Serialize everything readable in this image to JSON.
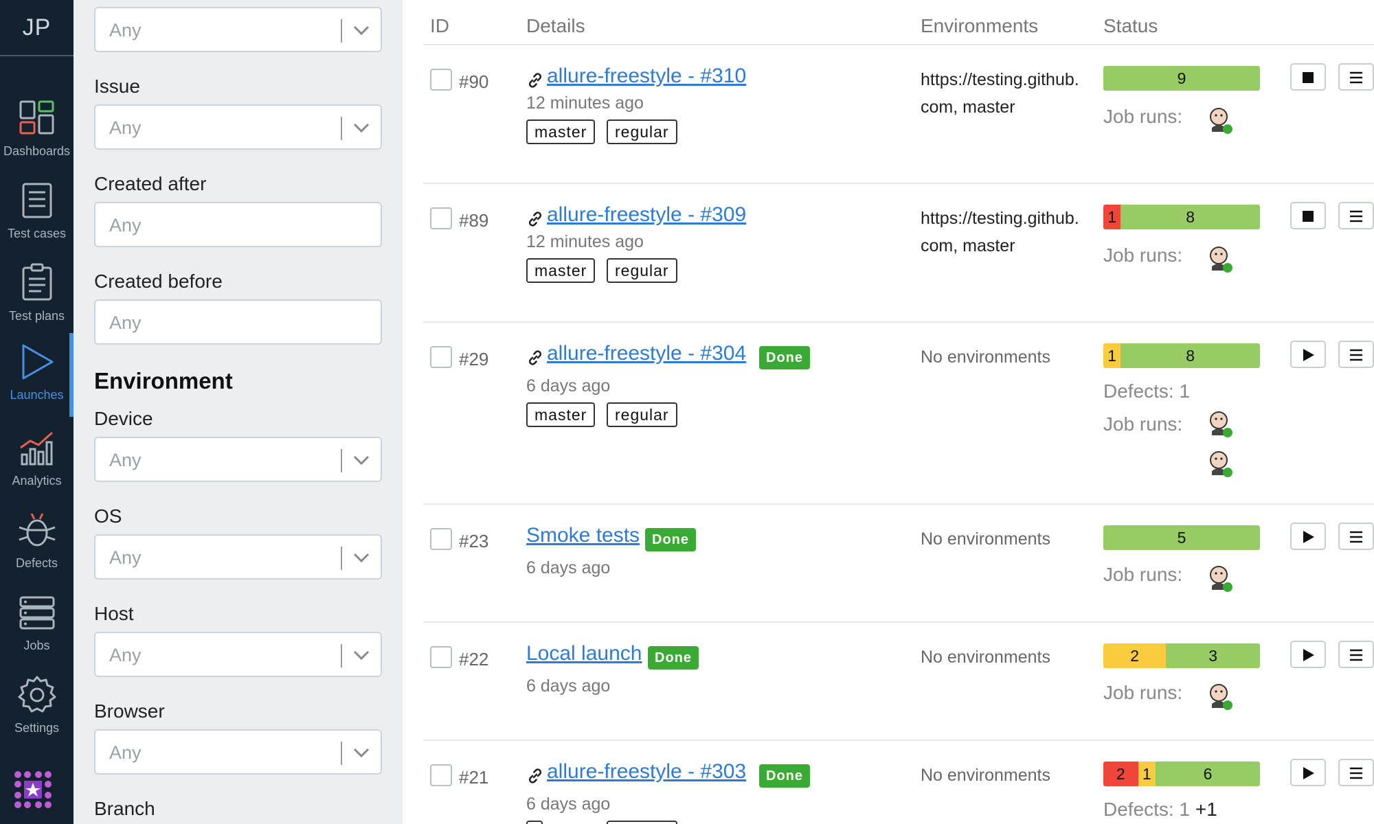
{
  "nav": {
    "brand": "JP",
    "items": [
      {
        "label": "Dashboards",
        "icon": "dashboards-icon"
      },
      {
        "label": "Test cases",
        "icon": "test-cases-icon"
      },
      {
        "label": "Test plans",
        "icon": "test-plans-icon"
      },
      {
        "label": "Launches",
        "icon": "launches-icon",
        "active": true
      },
      {
        "label": "Analytics",
        "icon": "analytics-icon"
      },
      {
        "label": "Defects",
        "icon": "defects-icon"
      },
      {
        "label": "Jobs",
        "icon": "jobs-icon"
      },
      {
        "label": "Settings",
        "icon": "settings-icon"
      }
    ]
  },
  "filters": {
    "top_value": "Any",
    "issue": {
      "label": "Issue",
      "value": "Any"
    },
    "created_after": {
      "label": "Created after",
      "value": "Any"
    },
    "created_before": {
      "label": "Created before",
      "value": "Any"
    },
    "environment_heading": "Environment",
    "device": {
      "label": "Device",
      "value": "Any"
    },
    "os": {
      "label": "OS",
      "value": "Any"
    },
    "host": {
      "label": "Host",
      "value": "Any"
    },
    "browser": {
      "label": "Browser",
      "value": "Any"
    },
    "branch": {
      "label": "Branch"
    }
  },
  "table": {
    "headers": {
      "id": "ID",
      "details": "Details",
      "environments": "Environments",
      "status": "Status"
    },
    "job_runs_label": "Job runs:",
    "done_label": "Done",
    "rows": [
      {
        "id": "#90",
        "title": "allure-freestyle - #310",
        "ago": "12 minutes ago",
        "tags": [
          "master",
          "regular"
        ],
        "env_line1": "https://testing.github.",
        "env_line2": "com, master",
        "bar": [
          {
            "v": 9,
            "c": "green"
          }
        ]
      },
      {
        "id": "#89",
        "title": "allure-freestyle - #309",
        "ago": "12 minutes ago",
        "tags": [
          "master",
          "regular"
        ],
        "env_line1": "https://testing.github.",
        "env_line2": "com, master",
        "bar": [
          {
            "v": 1,
            "c": "red"
          },
          {
            "v": 8,
            "c": "green"
          }
        ]
      },
      {
        "id": "#29",
        "title": "allure-freestyle - #304",
        "ago": "6 days ago",
        "tags": [
          "master",
          "regular"
        ],
        "env": "No environments",
        "bar": [
          {
            "v": 1,
            "c": "yellow"
          },
          {
            "v": 8,
            "c": "green"
          }
        ],
        "defects": "Defects: 1"
      },
      {
        "id": "#23",
        "title": "Smoke tests",
        "ago": "6 days ago",
        "env": "No environments",
        "bar": [
          {
            "v": 5,
            "c": "green"
          }
        ]
      },
      {
        "id": "#22",
        "title": "Local launch",
        "ago": "6 days ago",
        "env": "No environments",
        "bar": [
          {
            "v": 2,
            "c": "yellow"
          },
          {
            "v": 3,
            "c": "green"
          }
        ]
      },
      {
        "id": "#21",
        "title": "allure-freestyle - #303",
        "ago": "6 days ago",
        "env": "No environments",
        "bar": [
          {
            "v": 2,
            "c": "red"
          },
          {
            "v": 1,
            "c": "yellow"
          },
          {
            "v": 6,
            "c": "green"
          }
        ],
        "defects_prefix": "Defects: 1",
        "defects_extra": "+1"
      }
    ]
  },
  "colors": {
    "accent": "#4a90e2",
    "link": "#2e7bd6",
    "done": "#3aaa35",
    "green": "#97cc64",
    "yellow": "#fbcb3f",
    "red": "#f0463a",
    "nav_bg": "#14222f"
  }
}
